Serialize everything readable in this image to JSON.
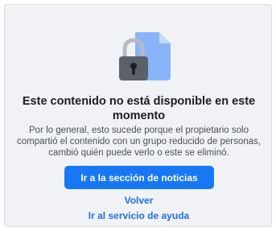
{
  "message": {
    "title": "Este contenido no está disponible en este momento",
    "description": "Por lo general, esto sucede porque el propietario solo compartió el contenido con un grupo reducido de personas, cambió quién puede verlo o este se eliminó."
  },
  "actions": {
    "primary_label": "Ir a la sección de noticias",
    "back_label": "Volver",
    "help_label": "Ir al servicio de ayuda"
  },
  "icons": {
    "illustration": "locked-document-icon"
  },
  "colors": {
    "background": "#f0f2f5",
    "primary_button": "#1877f2",
    "link": "#216fdb",
    "title_text": "#1c1e21",
    "body_text": "#4b4f56"
  }
}
